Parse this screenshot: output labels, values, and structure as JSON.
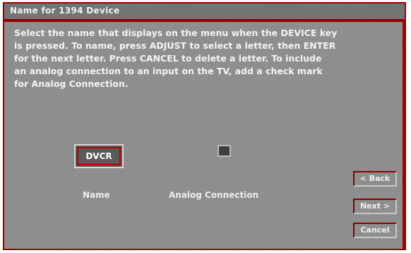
{
  "dialog": {
    "title": "Name for 1394 Device",
    "instructions": [
      "Select the name that displays on the menu when the DEVICE key",
      "is pressed.  To name, press ADJUST to select a letter, then ENTER",
      "for the next letter. Press CANCEL to delete a letter. To include",
      "an analog connection to an input on the TV, add a check mark",
      "for Analog Connection."
    ],
    "name_value": "DVCR",
    "name_label": "Name",
    "analog_label": "Analog Connection",
    "analog_checked": false,
    "buttons": {
      "back": "< Back",
      "next": "Next >",
      "cancel": "Cancel"
    }
  },
  "colors": {
    "accent": "#9a0000",
    "panel": "#8f8f8f",
    "text": "#f4f4f4"
  }
}
